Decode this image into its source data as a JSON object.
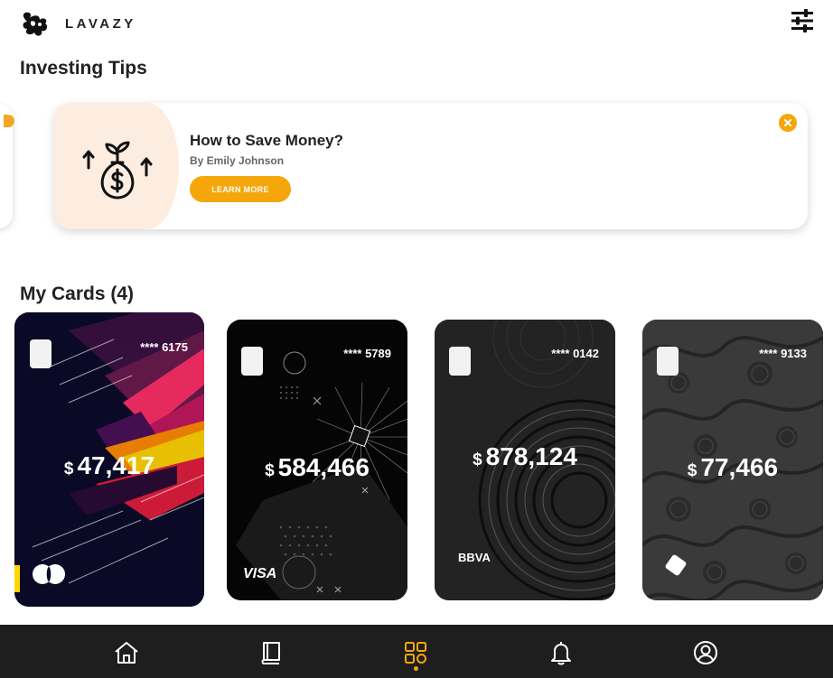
{
  "header": {
    "brand": "LAVAZY",
    "logo_icon": "lavazy-logo-icon",
    "filter_icon": "sliders-icon"
  },
  "tips": {
    "section_title": "Investing Tips",
    "items": [
      {
        "title": "How to Save Money?",
        "author": "By Emily Johnson",
        "cta": "LEARN MORE",
        "icon": "money-bag-plant-icon"
      }
    ],
    "accent_color": "#f5a60a"
  },
  "cards": {
    "section_title": "My Cards (4)",
    "items": [
      {
        "number": "**** 6175",
        "currency": "$",
        "amount": "47,417",
        "network": "mastercard-icon"
      },
      {
        "number": "**** 5789",
        "currency": "$",
        "amount": "584,466",
        "network": "VISA"
      },
      {
        "number": "**** 0142",
        "currency": "$",
        "amount": "878,124",
        "network": "BBVA"
      },
      {
        "number": "**** 9133",
        "currency": "$",
        "amount": "77,466",
        "network": "card-logo-icon"
      }
    ]
  },
  "nav": {
    "items": [
      "home-icon",
      "book-icon",
      "grid-icon",
      "bell-icon",
      "profile-icon"
    ],
    "active": "grid-icon",
    "background": "#1e1e1e"
  }
}
